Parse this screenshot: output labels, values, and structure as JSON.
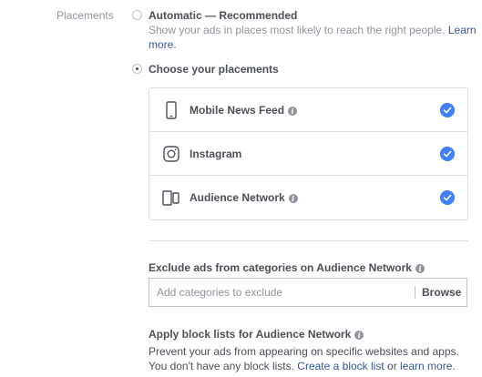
{
  "placements": {
    "section_label": "Placements",
    "automatic": {
      "title": "Automatic — Recommended",
      "description": "Show your ads in places most likely to reach the right people.",
      "learn_more": "Learn more."
    },
    "manual": {
      "title": "Choose your placements",
      "selected": true
    },
    "items": [
      {
        "label": "Mobile News Feed",
        "icon": "mobile-phone-icon",
        "has_info": true,
        "checked": true
      },
      {
        "label": "Instagram",
        "icon": "instagram-icon",
        "has_info": false,
        "checked": true
      },
      {
        "label": "Audience Network",
        "icon": "audience-network-icon",
        "has_info": true,
        "checked": true
      }
    ]
  },
  "exclude": {
    "label": "Exclude ads from categories on Audience Network",
    "placeholder": "Add categories to exclude",
    "browse_label": "Browse"
  },
  "block_lists": {
    "label": "Apply block lists for Audience Network",
    "line1": "Prevent your ads from appearing on specific websites and apps.",
    "line2_prefix": "You don't have any block lists.",
    "create_link": "Create a block list",
    "or_text": "or",
    "learn_more": "learn more."
  },
  "colors": {
    "accent_check": "#4080ff",
    "link": "#365899",
    "muted_text": "#90949c",
    "border": "#dddfe2"
  }
}
